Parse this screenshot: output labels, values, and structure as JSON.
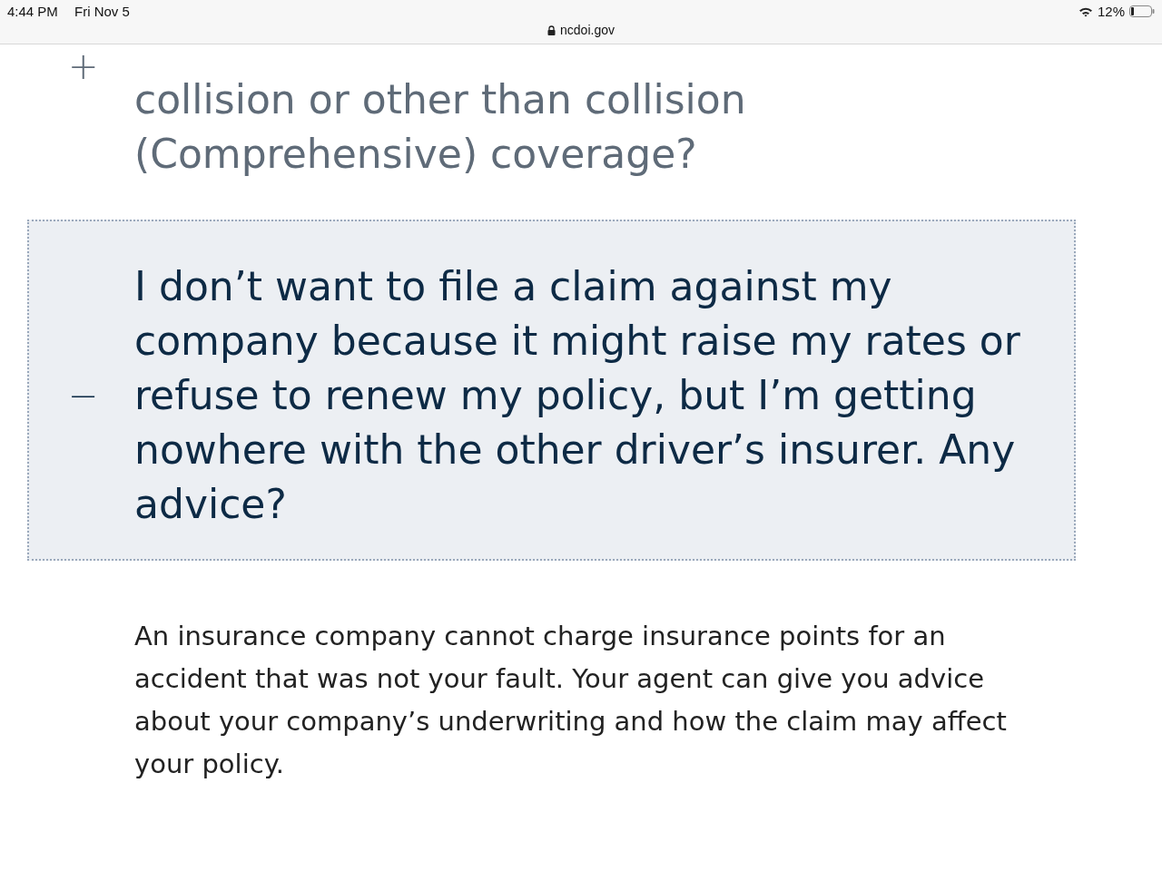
{
  "status_bar": {
    "time": "4:44 PM",
    "date": "Fri Nov 5",
    "url": "ncdoi.gov",
    "battery": "12%"
  },
  "faq": [
    {
      "toggle": "+",
      "expanded": false,
      "question": "collision or other than collision (Comprehensive) coverage?"
    },
    {
      "toggle": "−",
      "expanded": true,
      "question": "I don’t want to file a claim against my company because it might raise my rates or refuse to renew my policy, but I’m getting nowhere with the other driver’s insurer. Any advice?",
      "answer": "An insurance company cannot charge insurance points for an accident that was not your fault. Your agent can give you advice about your company’s underwriting and how the claim may affect your policy."
    }
  ]
}
